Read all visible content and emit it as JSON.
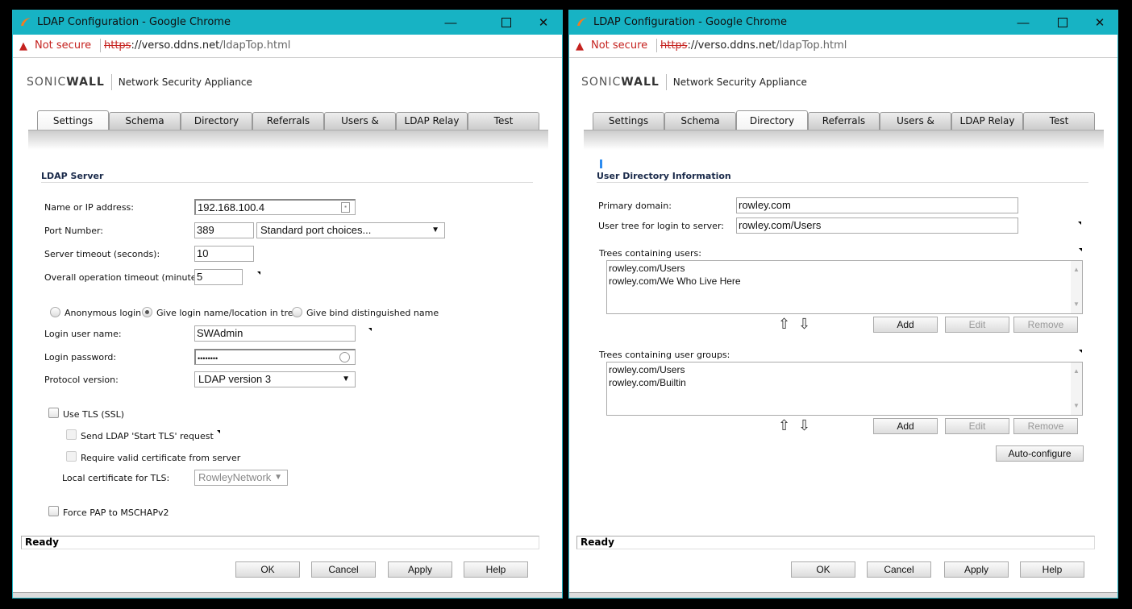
{
  "windows": [
    {
      "title": "LDAP Configuration - Google Chrome",
      "security_label": "Not secure",
      "url_scheme": "https",
      "url_rest_host": "://verso.ddns.net",
      "url_path": "/ldapTop.html",
      "brand_name_1": "SONIC",
      "brand_name_2": "WALL",
      "product": "Network Security Appliance",
      "tabs": [
        "Settings",
        "Schema",
        "Directory",
        "Referrals",
        "Users & Groups",
        "LDAP Relay",
        "Test"
      ],
      "active_tab": "Settings",
      "section_title": "LDAP Server",
      "fields": {
        "name_label": "Name or IP address:",
        "name_value": "192.168.100.4",
        "port_label": "Port Number:",
        "port_value": "389",
        "port_choices": "Standard port choices...",
        "server_timeout_label": "Server timeout (seconds):",
        "server_timeout_value": "10",
        "op_timeout_label": "Overall operation timeout (minutes):",
        "op_timeout_value": "5",
        "radio_anonymous": "Anonymous login",
        "radio_give_login": "Give login name/location in tree",
        "radio_bind_dn": "Give bind distinguished name",
        "selected_login_mode": "Give login name/location in tree",
        "login_user_label": "Login user name:",
        "login_user_value": "SWAdmin",
        "login_password_label": "Login password:",
        "login_password_value": "••••••••",
        "protocol_label": "Protocol version:",
        "protocol_value": "LDAP version 3",
        "use_tls_label": "Use TLS (SSL)",
        "use_tls_checked": false,
        "start_tls_label": "Send LDAP 'Start TLS' request",
        "require_cert_label": "Require valid certificate from server",
        "local_cert_label": "Local certificate for TLS:",
        "local_cert_value": "RowleyNetwork",
        "force_pap_label": "Force PAP to MSCHAPv2",
        "force_pap_checked": false
      },
      "status": "Ready",
      "buttons": {
        "ok": "OK",
        "cancel": "Cancel",
        "apply": "Apply",
        "help": "Help"
      }
    },
    {
      "title": "LDAP Configuration - Google Chrome",
      "security_label": "Not secure",
      "url_scheme": "https",
      "url_rest_host": "://verso.ddns.net",
      "url_path": "/ldapTop.html",
      "brand_name_1": "SONIC",
      "brand_name_2": "WALL",
      "product": "Network Security Appliance",
      "tabs": [
        "Settings",
        "Schema",
        "Directory",
        "Referrals",
        "Users & Groups",
        "LDAP Relay",
        "Test"
      ],
      "active_tab": "Directory",
      "section_title": "User Directory Information",
      "fields": {
        "primary_domain_label": "Primary domain:",
        "primary_domain_value": "rowley.com",
        "user_tree_label": "User tree for login to server:",
        "user_tree_value": "rowley.com/Users",
        "trees_users_label": "Trees containing users:",
        "trees_users": [
          "rowley.com/Users",
          "rowley.com/We Who Live Here"
        ],
        "trees_groups_label": "Trees containing user groups:",
        "trees_groups": [
          "rowley.com/Users",
          "rowley.com/Builtin"
        ],
        "add": "Add",
        "edit": "Edit",
        "remove": "Remove",
        "auto_configure": "Auto-configure"
      },
      "status": "Ready",
      "buttons": {
        "ok": "OK",
        "cancel": "Cancel",
        "apply": "Apply",
        "help": "Help"
      }
    }
  ]
}
